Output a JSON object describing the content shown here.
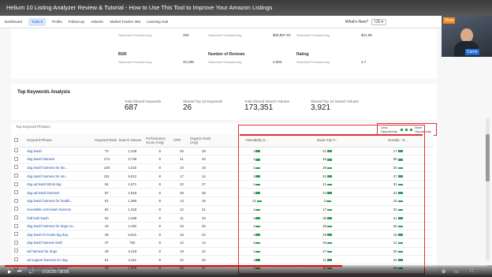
{
  "video": {
    "title": "Helium 10 Listing Analyzer Review & Tutorial - How to Use This Tool to Improve Your Amazon Listings",
    "progress": 0.7,
    "time": "0:16:23 / 26:05"
  },
  "header": {
    "nav": [
      "Dashboard",
      "Tools ▾",
      "Profits",
      "Follow-Up",
      "Adtomic",
      "Market Tracker 360",
      "Learning Hub"
    ],
    "whats_new": "What's New?",
    "right": [
      "US ▾"
    ]
  },
  "webcam": {
    "badge1": "Vova",
    "badge2": "Carrie"
  },
  "stats": {
    "row1": [
      {
        "sub": "Searched Products Avg:",
        "val": "400"
      },
      {
        "sub": "Searched Products Avg:",
        "val": "$30,897.83"
      },
      {
        "sub": "Searched Products Avg:",
        "val": "$41.98"
      }
    ],
    "row2": [
      {
        "label": "BSR",
        "sub": "Searched Products Avg:",
        "val": "40,289"
      },
      {
        "label": "Number of Reviews",
        "sub": "Searched Products Avg:",
        "val": "2,693"
      },
      {
        "label": "Rating",
        "sub": "Searched Products Avg:",
        "val": "4.7"
      }
    ]
  },
  "tka": {
    "title": "Top Keywords Analysis",
    "metrics": [
      {
        "label": "Total Shared Keywords",
        "value": "687"
      },
      {
        "label": "Shared Top 10 Keywords",
        "value": "26"
      },
      {
        "label": "Total Shared Search Volume",
        "value": "173,351"
      },
      {
        "label": "Shared Top 10 Search Volume",
        "value": "3,921"
      }
    ]
  },
  "table": {
    "title": "Top Keyword Phrases",
    "legend": {
      "less": "Less Opportunity",
      "more": "More Opportunity"
    },
    "headers": [
      "Keyword Phrase",
      "Keyword Rank",
      "Search Volume",
      "Performance Score (Avg)",
      "CPR",
      "Organic Rank (Avg)",
      "HamsBelly D...",
      "Dude Grip F...",
      "Nonslip - R..."
    ],
    "rows": [
      {
        "kw": "dog leash",
        "rank": "70",
        "sv": "1,249",
        "ps": "8",
        "cpr": "45",
        "or": "29",
        "o1": "1",
        "o2": "21",
        "o3": "17"
      },
      {
        "kw": "dog leash harness",
        "rank": "173",
        "sv": "3,749",
        "ps": "8",
        "cpr": "41",
        "or": "33",
        "o1": "1",
        "o2": "45",
        "o3": "56"
      },
      {
        "kw": "dog leash harness for las...",
        "rank": "149",
        "sv": "4,215",
        "ps": "8",
        "cpr": "10",
        "or": "19",
        "o1": "1",
        "o2": "28",
        "o3": "26"
      },
      {
        "kw": "dog leash harness for sm...",
        "rank": "151",
        "sv": "9,012",
        "ps": "8",
        "cpr": "17",
        "or": "14",
        "o1": "1",
        "o2": "51",
        "o3": "47"
      },
      {
        "kw": "dog ad leash blind dog",
        "rank": "84",
        "sv": "1,671",
        "ps": "8",
        "cpr": "22",
        "or": "27",
        "o1": "1",
        "o2": "11",
        "o3": "31"
      },
      {
        "kw": "dog ad leash harness",
        "rank": "87",
        "sv": "2,918",
        "ps": "8",
        "cpr": "28",
        "or": "28",
        "o1": "1",
        "o2": "44",
        "o3": "23"
      },
      {
        "kw": "dog leash harness for health...",
        "rank": "61",
        "sv": "1,369",
        "ps": "8",
        "cpr": "13",
        "or": "16",
        "o1": "13",
        "o2": "3",
        "o3": "15"
      },
      {
        "kw": "reversible cars leash harness",
        "rank": "84",
        "sv": "1,318",
        "ps": "8",
        "cpr": "12",
        "or": "21",
        "o1": "1",
        "o2": "17",
        "o3": "22"
      },
      {
        "kw": "fold lash leash",
        "rank": "52",
        "sv": "4,189",
        "ps": "8",
        "cpr": "11",
        "or": "23",
        "o1": "1",
        "o2": "36",
        "o3": "21"
      },
      {
        "kw": "dog leash harness for dogs no...",
        "rank": "43",
        "sv": "4,182",
        "ps": "8",
        "cpr": "34",
        "or": "20",
        "o1": "1",
        "o2": "28",
        "o3": "26"
      },
      {
        "kw": "dog leash for leads big dog",
        "rank": "39",
        "sv": "5,631",
        "ps": "8",
        "cpr": "16",
        "or": "22",
        "o1": "1",
        "o2": "28",
        "o3": "18"
      },
      {
        "kw": "dog leash harness both",
        "rank": "47",
        "sv": "762",
        "ps": "8",
        "cpr": "12",
        "or": "14",
        "o1": "4",
        "o2": "26",
        "o3": "14"
      },
      {
        "kw": "ad harness for dogs",
        "rank": "49",
        "sv": "4,418",
        "ps": "8",
        "cpr": "18",
        "or": "22",
        "o1": "1",
        "o2": "27",
        "o3": "26"
      },
      {
        "kw": "ad support harness for dog",
        "rank": "61",
        "sv": "2,311",
        "ps": "8",
        "cpr": "22",
        "or": "20",
        "o1": "1",
        "o2": "11",
        "o3": "25"
      },
      {
        "kw": "dog harness for dogs leash",
        "rank": "40",
        "sv": "1,009",
        "ps": "8",
        "cpr": "25",
        "or": "37",
        "o1": "1",
        "o2": "21",
        "o3": "18"
      }
    ]
  }
}
